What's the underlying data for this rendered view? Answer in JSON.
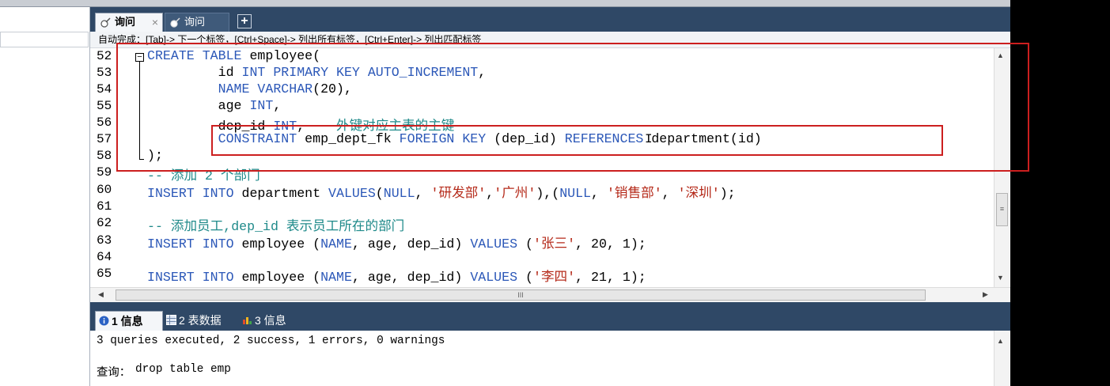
{
  "tabs": {
    "query_tab_label": "询问",
    "query_tab_close": "×",
    "second_tab_label": "询问",
    "new_tab": "+"
  },
  "hint": "自动完成：[Tab]-> 下一个标签，[Ctrl+Space]-> 列出所有标签，[Ctrl+Enter]-> 列出匹配标签",
  "editor": {
    "line_numbers": [
      "52",
      "53",
      "54",
      "55",
      "56",
      "57",
      "58",
      "59",
      "60",
      "61",
      "62",
      "63",
      "64",
      "65"
    ],
    "fold_marker": "−"
  },
  "results_tabs": {
    "tab1": "1 信息",
    "tab2": "2 表数据",
    "tab3": "3 信息"
  },
  "results": {
    "summary": "3 queries executed, 2 success, 1 errors, 0 warnings",
    "query_label": "查询：",
    "query_text": "drop table emp"
  },
  "scroll": {
    "up": "▲",
    "down": "▼",
    "left": "◀",
    "right": "▶",
    "grip_v": "≡",
    "grip_h": "III"
  },
  "colors": {
    "keyword": "#2c58b8",
    "comment": "#1f8a8a",
    "string": "#b52a1a",
    "tabbar": "#2f4866",
    "annotation": "#cc1f1f"
  }
}
